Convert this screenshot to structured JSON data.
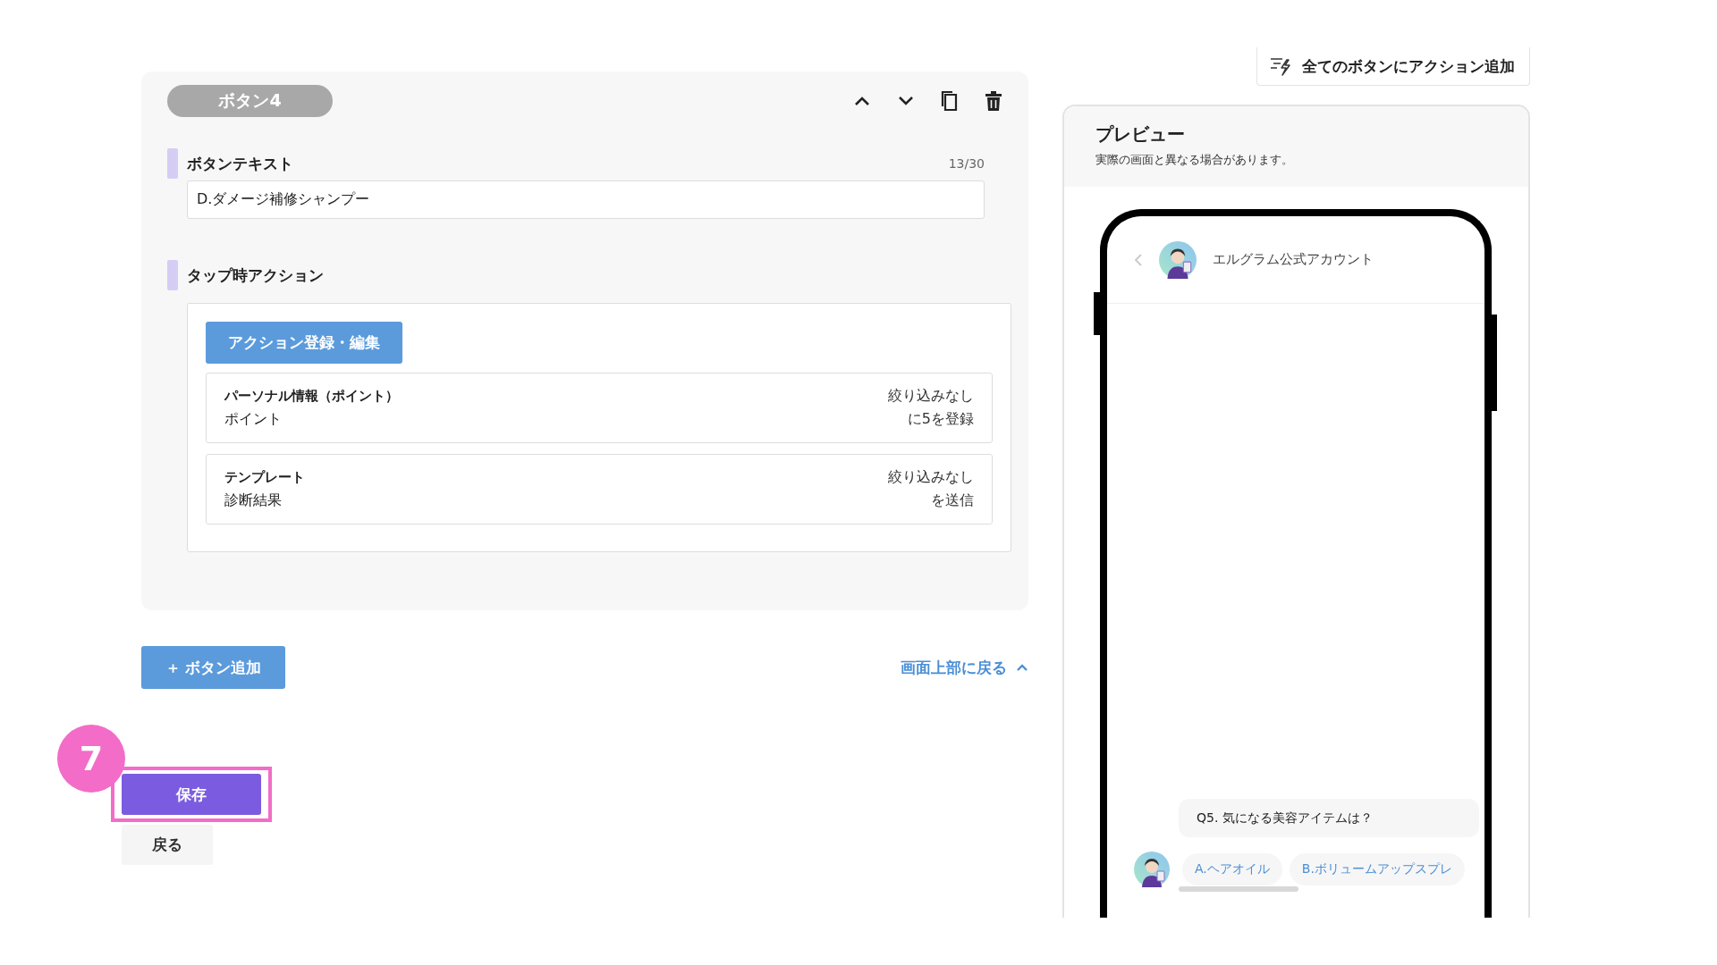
{
  "editor": {
    "badge": "ボタン4",
    "tools": [
      {
        "kind": "up"
      },
      {
        "kind": "down"
      },
      {
        "kind": "copy"
      },
      {
        "kind": "delete"
      }
    ],
    "button_text": {
      "label": "ボタンテキスト",
      "counter": "13/30",
      "value": "D.ダメージ補修シャンプー"
    },
    "tap_action": {
      "label": "タップ時アクション",
      "edit_button": "アクション登録・編集",
      "actions": [
        {
          "title": "パーソナル情報（ポイント）",
          "detail": "ポイント",
          "filter": "絞り込みなし",
          "result": "に5を登録"
        },
        {
          "title": "テンプレート",
          "detail": "診断結果",
          "filter": "絞り込みなし",
          "result": "を送信"
        }
      ]
    }
  },
  "add_button": "＋ ボタン追加",
  "back_to_top": "画面上部に戻る",
  "step_badge": "7",
  "save_button": "保存",
  "back_button": "戻る",
  "add_action_all": "全てのボタンにアクション追加",
  "preview": {
    "title": "プレビュー",
    "note": "実際の画面と異なる場合があります。",
    "account_name": "エルグラム公式アカウント",
    "message": "Q5. 気になる美容アイテムは？",
    "quick_replies": [
      "A.ヘアオイル",
      "B.ボリュームアップスプレ"
    ]
  }
}
